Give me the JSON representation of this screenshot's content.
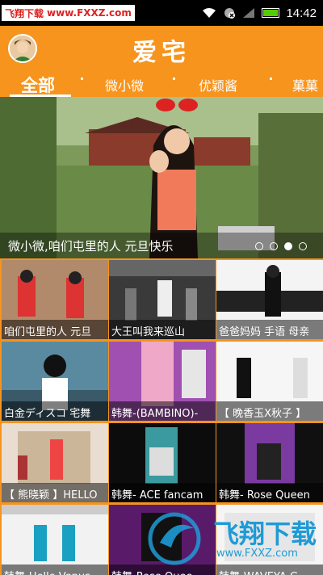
{
  "status_bar": {
    "watermark_name": "飞翔下载",
    "watermark_url": "www.FXXZ.com",
    "time": "14:42"
  },
  "header": {
    "app_title": "爱宅",
    "tabs": [
      {
        "label": "全部",
        "active": true
      },
      {
        "label": "微小微",
        "active": false
      },
      {
        "label": "优颖酱",
        "active": false
      },
      {
        "label": "菓菓",
        "active": false
      }
    ]
  },
  "banner": {
    "caption": "微小微,咱们屯里的人 元旦快乐",
    "page_count": 4,
    "current_page": 3
  },
  "videos": [
    {
      "title": "咱们屯里的人 元旦"
    },
    {
      "title": "大王叫我来巡山"
    },
    {
      "title": "爸爸妈妈 手语 母亲"
    },
    {
      "title": "白金ディスコ 宅舞"
    },
    {
      "title": "韩舞-(BAMBINO)-"
    },
    {
      "title": "【 晚香玉X秋子 】"
    },
    {
      "title": "【 熊晓颖 】HELLO"
    },
    {
      "title": "韩舞- ACE  fancam"
    },
    {
      "title": "韩舞- Rose Queen"
    },
    {
      "title": "韩舞-Hello Venus"
    },
    {
      "title": "韩舞-Rose Quee"
    },
    {
      "title": "韩舞-WAVEYA G"
    }
  ],
  "watermark_bottom": {
    "name": "飞翔下载",
    "url": "www.FXXZ.com"
  },
  "colors": {
    "accent": "#f7941d",
    "watermark_blue": "#1e9bd7"
  }
}
